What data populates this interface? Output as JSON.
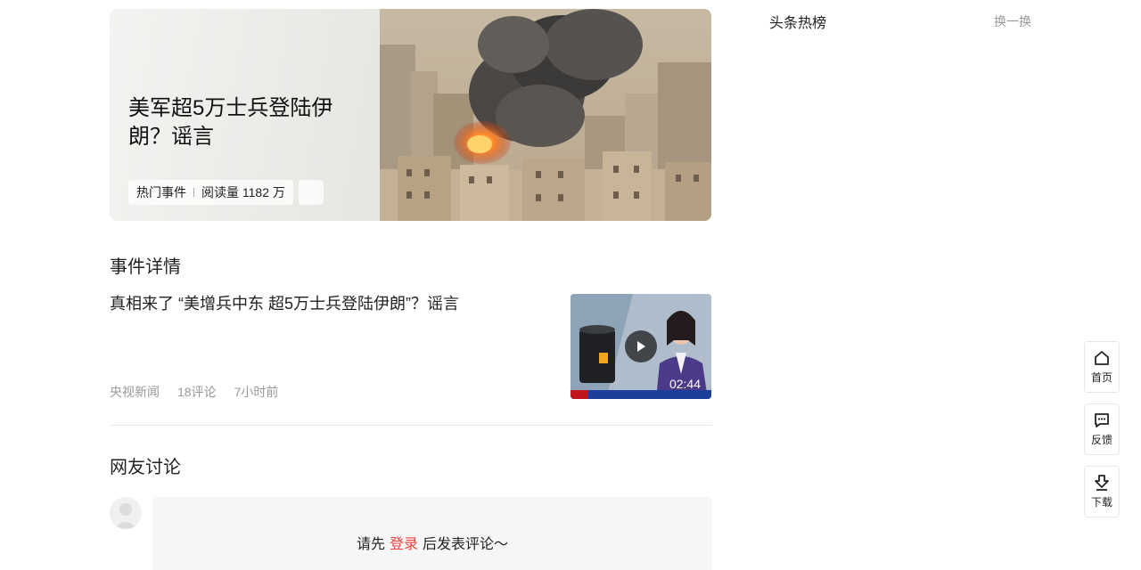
{
  "hero": {
    "title": "美军超5万士兵登陆伊朗？谣言",
    "tag": "热门事件",
    "read_count": "阅读量 1182 万"
  },
  "sections": {
    "details": "事件详情",
    "discussion": "网友讨论"
  },
  "article": {
    "title": "真相来了 “美增兵中东 超5万士兵登陆伊朗”？谣言",
    "source": "央视新闻",
    "comments": "18评论",
    "time": "7小时前",
    "duration": "02:44"
  },
  "comment": {
    "before": "请先",
    "login": "登录",
    "after": "后发表评论～"
  },
  "hot_list": {
    "title": "头条热榜",
    "refresh": "换一换"
  },
  "side_nav": {
    "home": "首页",
    "feedback": "反馈",
    "download": "下载"
  },
  "colors": {
    "accent": "#f04142",
    "meta_gray": "#999999"
  },
  "icons": [
    "play-icon",
    "share-icon",
    "home-icon",
    "feedback-icon",
    "download-icon",
    "avatar-icon"
  ]
}
